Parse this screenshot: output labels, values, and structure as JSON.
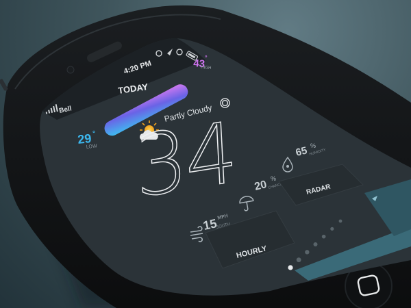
{
  "status_bar": {
    "carrier": "Bell",
    "time": "4:20 PM"
  },
  "header": {
    "title": "TODAY"
  },
  "temperature_range": {
    "low_value": "29",
    "low_unit": "°",
    "low_label": "LOW",
    "high_value": "43",
    "high_unit": "°",
    "high_label": "HIGH",
    "gradient_start": "#3cc0f0",
    "gradient_mid": "#6a63e6",
    "gradient_end": "#d57af0"
  },
  "current": {
    "condition": "Partly Cloudy",
    "condition_icon": "partly-cloudy-icon",
    "temperature": "34",
    "degree_symbol": "°"
  },
  "stats": {
    "humidity": {
      "value": "65",
      "unit": "%",
      "label": "HUMIDITY",
      "icon": "humidity-drop-icon"
    },
    "chance": {
      "value": "20",
      "unit": "%",
      "label": "CHANCE",
      "icon": "umbrella-icon"
    },
    "wind": {
      "value": "15",
      "unit": "MPH",
      "label": "SOUTH",
      "icon": "wind-icon"
    }
  },
  "buttons": {
    "radar": "RADAR",
    "hourly": "HOURLY"
  },
  "pagination": {
    "total": 7,
    "active": 0
  },
  "colors": {
    "accent_blue": "#3cb8ef",
    "accent_purple": "#cf74f0",
    "screen_bg": "#2b3338",
    "panel_teal": "#3a6a78"
  }
}
